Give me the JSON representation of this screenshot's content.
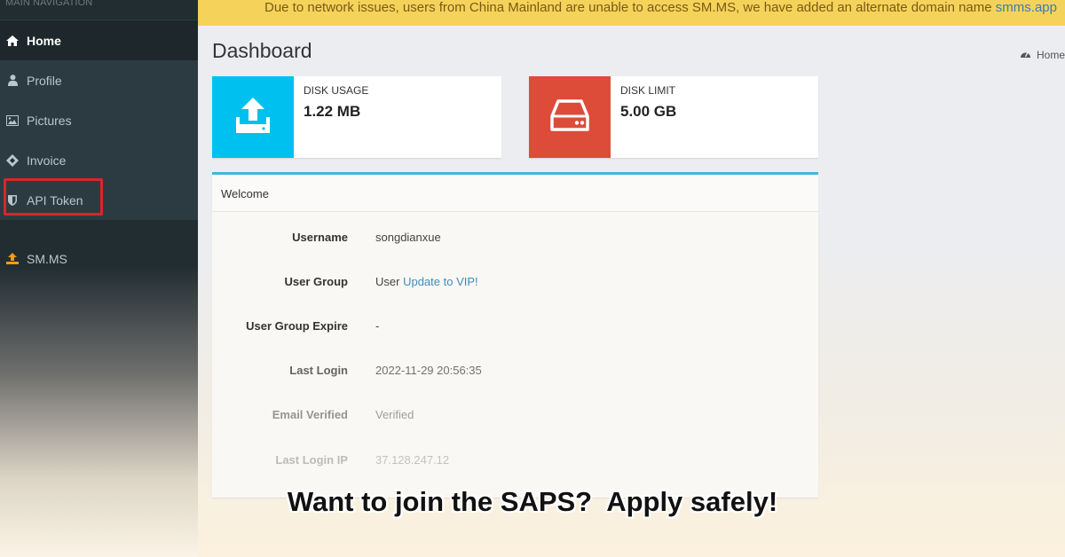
{
  "sidebar": {
    "header": "MAIN NAVIGATION",
    "items": [
      {
        "label": "Home",
        "icon": "dashboard-icon",
        "active": true
      },
      {
        "label": "Profile",
        "icon": "user-icon"
      },
      {
        "label": "Pictures",
        "icon": "picture-icon"
      },
      {
        "label": "Invoice",
        "icon": "ticket-icon"
      },
      {
        "label": "API Token",
        "icon": "shield-icon"
      }
    ],
    "extra": {
      "label": "SM.MS",
      "icon": "upload-icon"
    }
  },
  "banner": {
    "message": "Due to network issues, users from China Mainland are unable to access SM.MS, we have added an alternate domain name ",
    "link": "smms.app"
  },
  "header": {
    "title": "Dashboard",
    "breadcrumb": "Home"
  },
  "info_boxes": {
    "disk_usage": {
      "label": "DISK USAGE",
      "value": "1.22 MB",
      "color": "#00c0ef",
      "icon": "upload-icon"
    },
    "disk_limit": {
      "label": "DISK LIMIT",
      "value": "5.00 GB",
      "color": "#dd4b39",
      "icon": "hard-drive-icon"
    }
  },
  "welcome": {
    "title": "Welcome",
    "rows": [
      {
        "key": "Username",
        "value": "songdianxue"
      },
      {
        "key": "User Group",
        "value": "User",
        "link": "Update to VIP!"
      },
      {
        "key": "User Group Expire",
        "value": "-"
      },
      {
        "key": "Last Login",
        "value": "2022-11-29 20:56:35"
      },
      {
        "key": "Email Verified",
        "value": "Verified"
      },
      {
        "key": "Last Login IP",
        "value": "37.128.247.12"
      }
    ]
  },
  "caption": "Want to join the SAPS?  Apply safely!",
  "colors": {
    "sidebar_bg": "#222d32",
    "banner_bg": "#f5d35b",
    "panel_accent": "#3fb7d9",
    "link": "#3c8dbc"
  }
}
